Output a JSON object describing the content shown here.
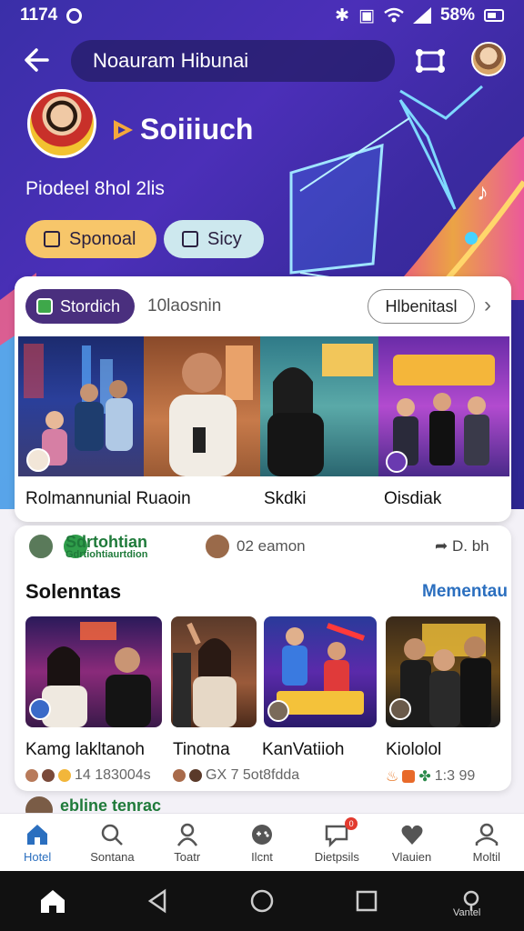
{
  "status_bar": {
    "time": "1174",
    "battery": "58%"
  },
  "header": {
    "search_text": "Noauram  Hibunai"
  },
  "profile": {
    "brand_name": "Soiiiuch",
    "subtitle": "Piodeel 8hol 2lis",
    "chips": [
      {
        "label": "Sponoal",
        "icon": "tablet-icon"
      },
      {
        "label": "Sicy",
        "icon": "square-icon"
      }
    ]
  },
  "section1": {
    "pill_label": "Stordich",
    "count_text": "10laosnin",
    "outline_button": "Hlbenitasl",
    "thumbnails": [
      {
        "caption": "Rolmannunial Ruaoin"
      },
      {
        "caption": ""
      },
      {
        "caption": "Skdki"
      },
      {
        "caption": "Oisdiak"
      }
    ]
  },
  "section2": {
    "channel_name": "Sdrtohtian",
    "channel_sub": "Gdrtiohtiaurtdion",
    "middle_text": "02 eamon",
    "share_text": "D. bh",
    "title": "Solenntas",
    "link": "Mementau",
    "videos": [
      {
        "caption": "Kamg lakltanoh",
        "meta": "14 183004s"
      },
      {
        "caption": "Tinotna",
        "meta": "GX 7 5ot8fdda"
      },
      {
        "caption": "KanVatiioh",
        "meta": ""
      },
      {
        "caption": "Kiololol",
        "meta": "1:3 99"
      }
    ]
  },
  "peek_text": "ebline tenrac",
  "bottom_nav": [
    {
      "label": "Hotel",
      "icon": "home-icon",
      "active": true
    },
    {
      "label": "Sontana",
      "icon": "search-icon"
    },
    {
      "label": "Toatr",
      "icon": "person-icon"
    },
    {
      "label": "Ilcnt",
      "icon": "controller-icon"
    },
    {
      "label": "Dietpsils",
      "icon": "chat-icon",
      "badge": "0"
    },
    {
      "label": "Vlauien",
      "icon": "heart-icon"
    },
    {
      "label": "Moltil",
      "icon": "profile-icon"
    }
  ],
  "system_nav": {
    "extra_label": "Vantel"
  }
}
